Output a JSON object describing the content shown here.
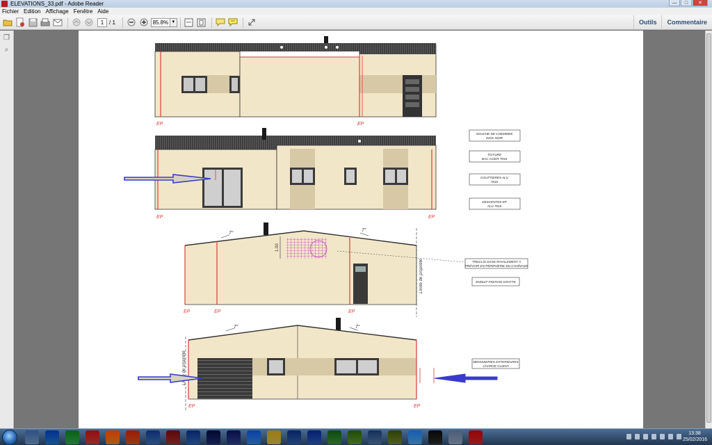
{
  "window": {
    "title": "ELEVATIONS_33.pdf - Adobe Reader",
    "controls": [
      "—",
      "□",
      "✕"
    ]
  },
  "menu": [
    "Fichier",
    "Edition",
    "Affichage",
    "Fenêtre",
    "Aide"
  ],
  "toolbar": {
    "page_current": "1",
    "page_total": "/ 1",
    "zoom": "85.8%",
    "right_tabs": [
      "Outils",
      "Commentaire"
    ]
  },
  "drawing": {
    "labels": {
      "ep": "EP",
      "slope": "7°",
      "height": "1.00",
      "property_limit": "Limite de propriété"
    },
    "legend": [
      {
        "line1": "SOUCHE DE CHEMINEE",
        "line2": "INOX NOIR"
      },
      {
        "line1": "TOITURE",
        "line2": "BAC ACIER 7016"
      },
      {
        "line1": "GOUTTIERES ALU",
        "line2": "7016"
      },
      {
        "line1": "DESCENTES EP",
        "line2": "ALU 7016"
      },
      {
        "line1": "TREILLIS DANS RAVALEMENT À",
        "line2": "PRÉVOIR EN PÉRIPHÉRIE DU CHAÎNAGE"
      },
      {
        "line1": "ENDUIT FINITION GRATTE",
        "line2": ""
      },
      {
        "line1": "MENUISERIES EXTERIEURES",
        "line2": "CHARGE CLIENT"
      }
    ],
    "colors": {
      "wall": "#f2e6c8",
      "band": "#d8c9a6",
      "roof": "#4a4a4a",
      "red": "#e03a3a",
      "arrow": "#3a3acf",
      "trellis": "#c63bc6"
    }
  },
  "taskbar": {
    "time": "13:38",
    "date": "25/02/2016",
    "app_colors": [
      "#6b8fb8",
      "#1e6fc1",
      "#2f9e47",
      "#c23b3b",
      "#e07a1c",
      "#c8501a",
      "#3a6aa8",
      "#9a2b2b",
      "#2b5fa3",
      "#1a2b6b",
      "#2c3b86",
      "#2f7fcf",
      "#c9b045",
      "#2d5c9e",
      "#2657a9",
      "#3a8a3a",
      "#5a8c2b",
      "#4a6f9a",
      "#6b7f2a",
      "#4a9ad6",
      "#2a2a2a",
      "#8a9ab0",
      "#c42424"
    ]
  }
}
